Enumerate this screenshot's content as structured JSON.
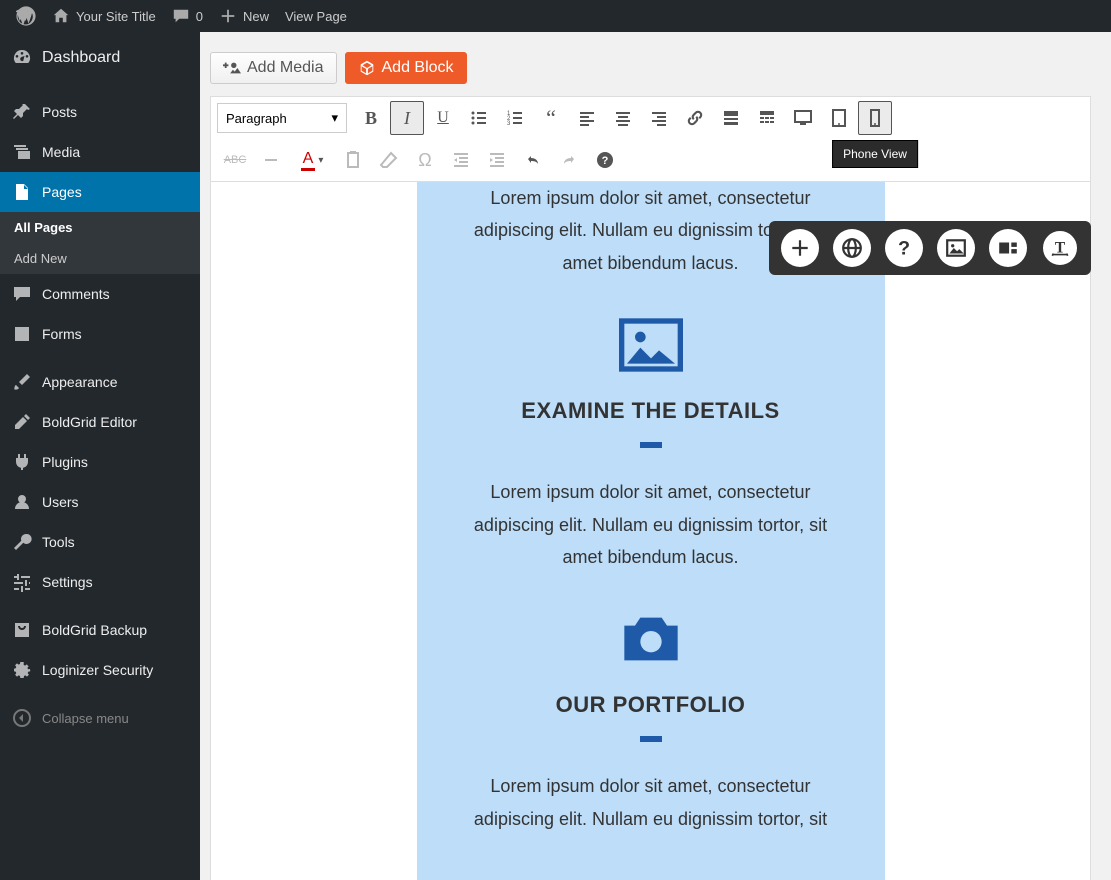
{
  "adminbar": {
    "site_title": "Your Site Title",
    "comments": "0",
    "new": "New",
    "view_page": "View Page"
  },
  "sidebar": {
    "items": [
      {
        "label": "Dashboard"
      },
      {
        "label": "Posts"
      },
      {
        "label": "Media"
      },
      {
        "label": "Pages"
      },
      {
        "label": "Comments"
      },
      {
        "label": "Forms"
      },
      {
        "label": "Appearance"
      },
      {
        "label": "BoldGrid Editor"
      },
      {
        "label": "Plugins"
      },
      {
        "label": "Users"
      },
      {
        "label": "Tools"
      },
      {
        "label": "Settings"
      },
      {
        "label": "BoldGrid Backup"
      },
      {
        "label": "Loginizer Security"
      }
    ],
    "sub": {
      "all_pages": "All Pages",
      "add_new": "Add New"
    },
    "collapse": "Collapse menu"
  },
  "buttons": {
    "add_media": "Add Media",
    "add_block": "Add Block"
  },
  "toolbar": {
    "format": "Paragraph",
    "tooltip": "Phone View"
  },
  "content": {
    "lorem": "Lorem ipsum dolor sit amet, consectetur adipiscing elit. Nullam eu dignissim tortor, sit amet bibendum lacus.",
    "lorem_cut": "Lorem ipsum dolor sit amet, consectetur adipiscing elit. Nullam eu dignissim tortor, sit",
    "title1": "EXAMINE THE DETAILS",
    "title2": "OUR PORTFOLIO"
  }
}
